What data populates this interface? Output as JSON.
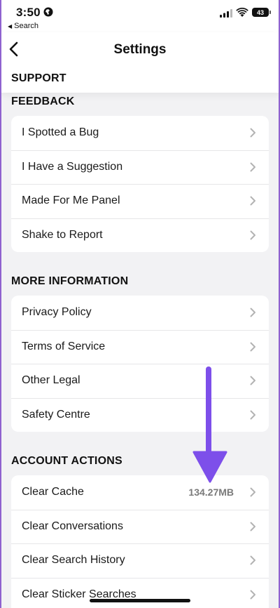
{
  "status": {
    "time": "3:50",
    "back_app": "Search",
    "battery": "43",
    "icons": [
      "globe-icon",
      "signal-icon",
      "wifi-icon",
      "battery-icon"
    ]
  },
  "header": {
    "title": "Settings",
    "back_icon": "chevron-left-icon",
    "top_section": "SUPPORT"
  },
  "sections": [
    {
      "heading": "FEEDBACK",
      "items": [
        {
          "label": "I Spotted a Bug"
        },
        {
          "label": "I Have a Suggestion"
        },
        {
          "label": "Made For Me Panel"
        },
        {
          "label": "Shake to Report"
        }
      ]
    },
    {
      "heading": "MORE INFORMATION",
      "items": [
        {
          "label": "Privacy Policy"
        },
        {
          "label": "Terms of Service"
        },
        {
          "label": "Other Legal"
        },
        {
          "label": "Safety Centre"
        }
      ]
    },
    {
      "heading": "ACCOUNT ACTIONS",
      "items": [
        {
          "label": "Clear Cache",
          "value": "134.27MB"
        },
        {
          "label": "Clear Conversations"
        },
        {
          "label": "Clear Search History"
        },
        {
          "label": "Clear Sticker Searches"
        }
      ]
    }
  ],
  "colors": {
    "accent_arrow": "#7d4fea",
    "frame_border": "#8f62cf",
    "background": "#f2f2f4",
    "card": "#ffffff"
  }
}
